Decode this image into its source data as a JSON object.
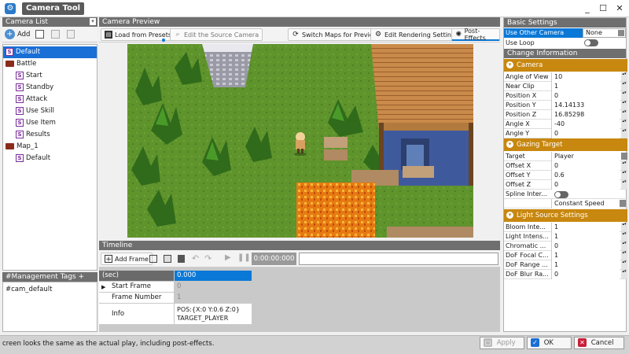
{
  "window": {
    "title": "Camera Tool",
    "min": "_",
    "max": "☐",
    "close": "✕"
  },
  "camera_list": {
    "header": "Camera List",
    "add_label": "Add",
    "items": [
      {
        "label": "Default",
        "level": 0,
        "type": "s",
        "selected": true
      },
      {
        "label": "Battle",
        "level": 0,
        "type": "folder"
      },
      {
        "label": "Start",
        "level": 1,
        "type": "s"
      },
      {
        "label": "Standby",
        "level": 1,
        "type": "s"
      },
      {
        "label": "Attack",
        "level": 1,
        "type": "s"
      },
      {
        "label": "Use Skill",
        "level": 1,
        "type": "s"
      },
      {
        "label": "Use Item",
        "level": 1,
        "type": "s"
      },
      {
        "label": "Results",
        "level": 1,
        "type": "s"
      },
      {
        "label": "Map_1",
        "level": 0,
        "type": "folder"
      },
      {
        "label": "Default",
        "level": 1,
        "type": "s"
      }
    ]
  },
  "tags": {
    "header": "#Management Tags + Notes",
    "value": "#cam_default"
  },
  "preview": {
    "header": "Camera Preview",
    "load_presets": "Load from Presets",
    "edit_source": "Edit the Source Camera",
    "switch_maps": "Switch Maps for Preview",
    "edit_rendering": "Edit Rendering Settings",
    "post_effects": "Post-Effects"
  },
  "timeline": {
    "header": "Timeline",
    "add_frame": "Add Frame",
    "time_display": "0:00:00:000",
    "unit_label": "(sec)",
    "unit_value": "0.000",
    "rows": [
      {
        "label": "Start Frame",
        "value": "0"
      },
      {
        "label": "Frame Number",
        "value": "1"
      }
    ],
    "info_label": "Info",
    "info_line1": "POS:{X:0 Y:0.6 Z:0}",
    "info_line2": "TARGET_PLAYER"
  },
  "basic_settings": {
    "header": "Basic Settings",
    "use_other_camera_label": "Use Other Camera",
    "use_other_camera_value": "None",
    "use_loop_label": "Use Loop"
  },
  "change_info": {
    "header": "Change Information",
    "camera_group": "Camera",
    "camera_props": [
      {
        "k": "Angle of View",
        "v": "10"
      },
      {
        "k": "Near Clip",
        "v": "1"
      },
      {
        "k": "Position X",
        "v": "0"
      },
      {
        "k": "Position Y",
        "v": "14.14133"
      },
      {
        "k": "Position Z",
        "v": "16.85298"
      },
      {
        "k": "Angle X",
        "v": "-40"
      },
      {
        "k": "Angle Y",
        "v": "0"
      }
    ],
    "gazing_group": "Gazing Target",
    "gazing_props": [
      {
        "k": "Target",
        "v": "Player"
      },
      {
        "k": "Offset X",
        "v": "0"
      },
      {
        "k": "Offset Y",
        "v": "0.6"
      },
      {
        "k": "Offset Z",
        "v": "0"
      }
    ],
    "spline_label": "Spline Inter...",
    "speed_value": "Constant Speed",
    "light_group": "Light Source Settings",
    "light_props": [
      {
        "k": "Bloom Inte...",
        "v": "1"
      },
      {
        "k": "Light Intens...",
        "v": "1"
      },
      {
        "k": "Chromatic ...",
        "v": "0"
      },
      {
        "k": "DoF Focal C...",
        "v": "1"
      },
      {
        "k": "DoF Range ...",
        "v": "1"
      },
      {
        "k": "DoF Blur Ra...",
        "v": "0"
      }
    ]
  },
  "status_text": "creen looks the same as the actual play, including post-effects.",
  "footer": {
    "apply": "Apply",
    "ok": "OK",
    "cancel": "Cancel"
  },
  "colors": {
    "accent": "#0a78d7",
    "selection": "#1a6fd6",
    "group": "#c8870e"
  }
}
